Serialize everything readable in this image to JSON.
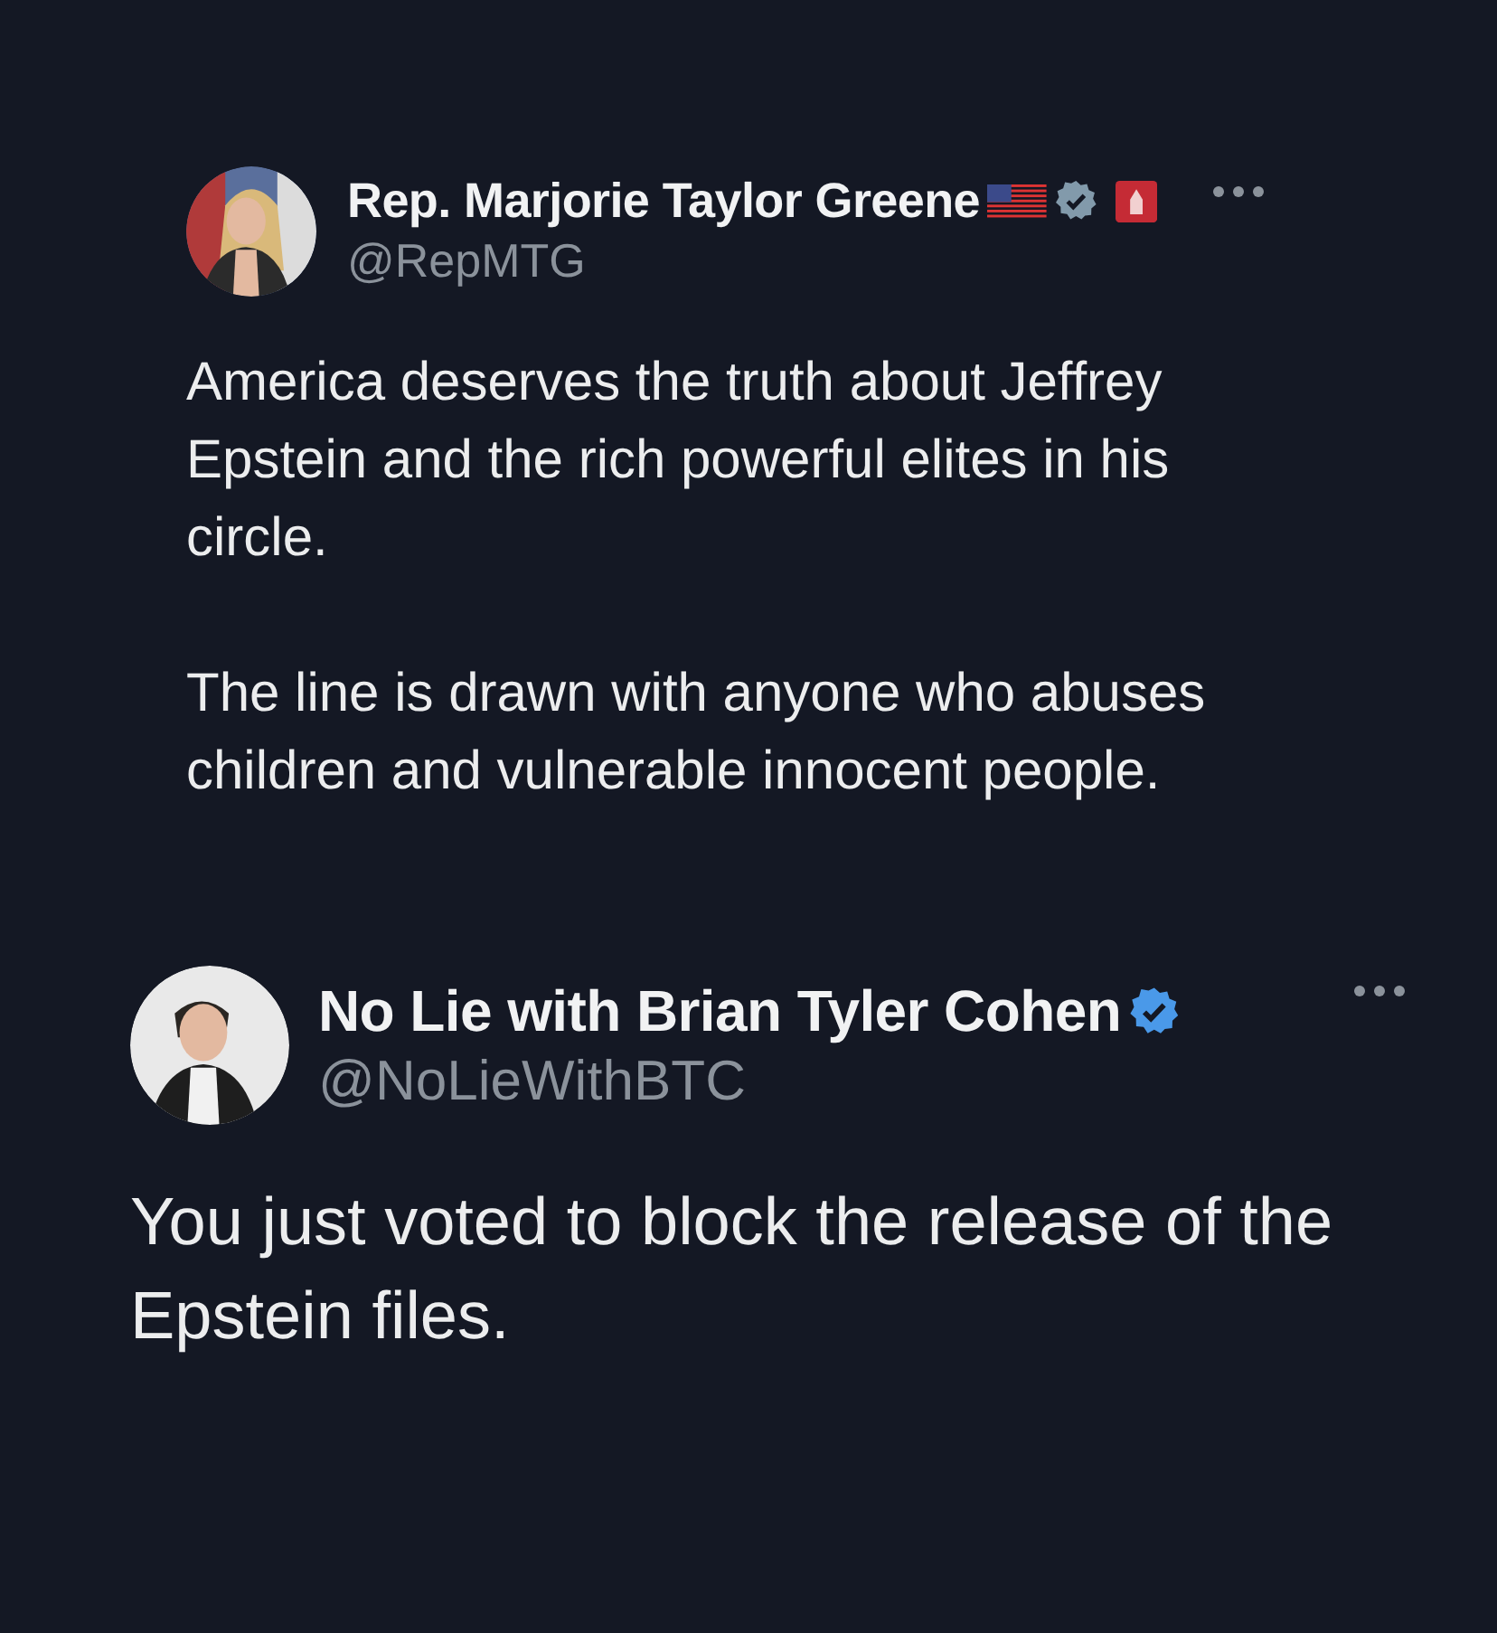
{
  "tweets": [
    {
      "kind": "post",
      "name": "Rep. Marjorie Taylor Greene",
      "handle": "@RepMTG",
      "flag": true,
      "affiliate_badge": true,
      "color": "#829aab",
      "paragraphs": [
        "America deserves the truth about Jeffrey Epstein and the rich powerful elites in his circle.",
        "The line is drawn with anyone who abuses children and vulnerable innocent people."
      ]
    },
    {
      "kind": "reply",
      "name": "No Lie with Brian Tyler Cohen",
      "handle": "@NoLieWithBTC",
      "flag": false,
      "affiliate_badge": false,
      "color": "#4a99e9",
      "paragraphs": [
        "You just voted to block the release of the Epstein files."
      ]
    }
  ]
}
